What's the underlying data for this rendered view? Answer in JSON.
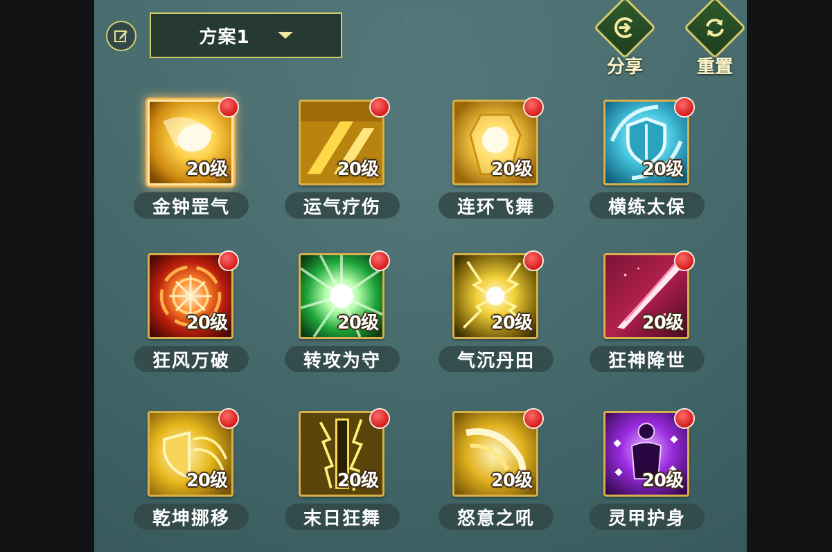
{
  "header": {
    "edit_icon": "edit-icon",
    "scheme_label": "方案1",
    "share_label": "分享",
    "reset_label": "重置"
  },
  "colors": {
    "panel_bg": "#456b6d",
    "gold_border": "#d9b14a",
    "badge_red": "#d61c1c",
    "action_green": "#2f5a2c"
  },
  "skills": [
    {
      "name": "金钟罡气",
      "level": "20级",
      "icon": "golden-bell-icon",
      "selected": true
    },
    {
      "name": "运气疗伤",
      "level": "20级",
      "icon": "healing-qi-icon"
    },
    {
      "name": "连环飞舞",
      "level": "20级",
      "icon": "chain-flying-dance-icon"
    },
    {
      "name": "横练太保",
      "level": "20级",
      "icon": "shield-icon"
    },
    {
      "name": "狂风万破",
      "level": "20级",
      "icon": "wind-burst-icon"
    },
    {
      "name": "转攻为守",
      "level": "20级",
      "icon": "green-burst-icon"
    },
    {
      "name": "气沉丹田",
      "level": "20级",
      "icon": "lightning-core-icon"
    },
    {
      "name": "狂神降世",
      "level": "20级",
      "icon": "blade-icon"
    },
    {
      "name": "乾坤挪移",
      "level": "20级",
      "icon": "golden-shield-icon"
    },
    {
      "name": "末日狂舞",
      "level": "20级",
      "icon": "lightning-pillar-icon"
    },
    {
      "name": "怒意之吼",
      "level": "20级",
      "icon": "roar-wave-icon"
    },
    {
      "name": "灵甲护身",
      "level": "20级",
      "icon": "spirit-armor-icon"
    }
  ]
}
